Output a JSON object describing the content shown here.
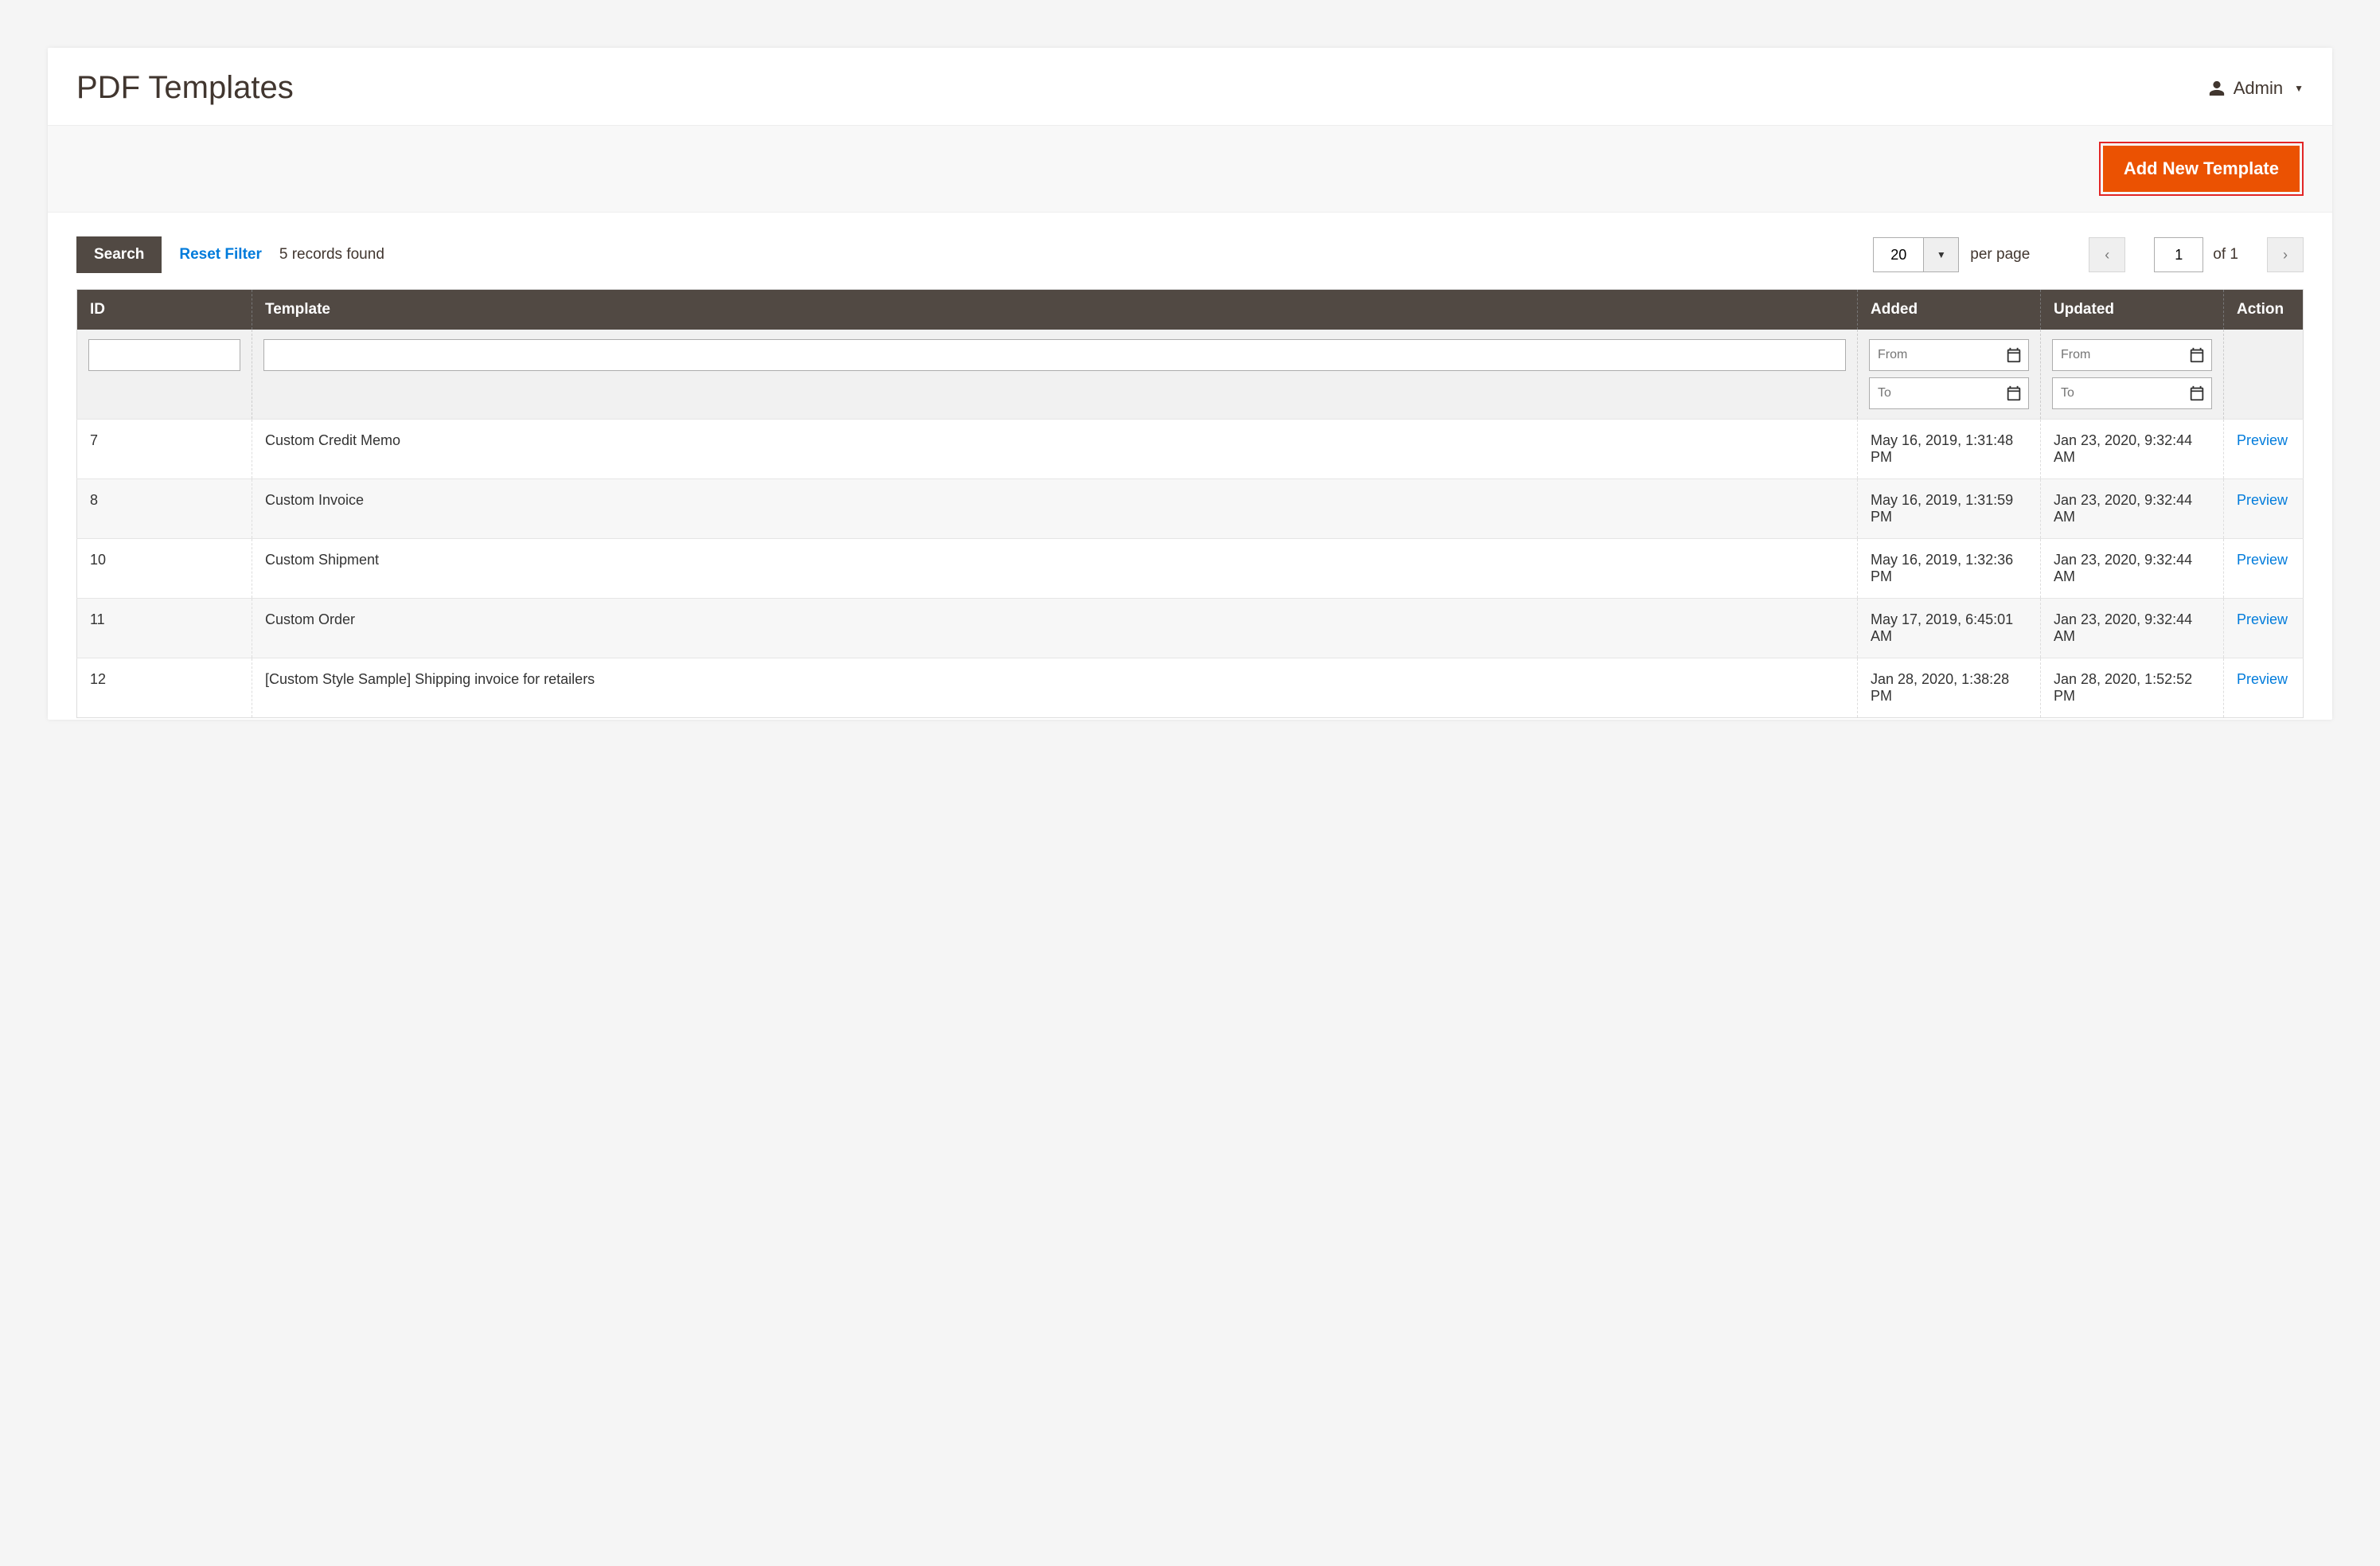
{
  "header": {
    "title": "PDF Templates",
    "user": "Admin"
  },
  "toolbar": {
    "add_label": "Add New Template"
  },
  "controls": {
    "search_label": "Search",
    "reset_label": "Reset Filter",
    "records_found": "5 records found",
    "per_page_value": "20",
    "per_page_label": "per page",
    "page_value": "1",
    "of_label": "of 1"
  },
  "columns": {
    "id": "ID",
    "template": "Template",
    "added": "Added",
    "updated": "Updated",
    "action": "Action"
  },
  "filters": {
    "from_ph": "From",
    "to_ph": "To"
  },
  "action_label": "Preview",
  "rows": [
    {
      "id": "7",
      "template": "Custom Credit Memo",
      "added": "May 16, 2019, 1:31:48 PM",
      "updated": "Jan 23, 2020, 9:32:44 AM"
    },
    {
      "id": "8",
      "template": "Custom Invoice",
      "added": "May 16, 2019, 1:31:59 PM",
      "updated": "Jan 23, 2020, 9:32:44 AM"
    },
    {
      "id": "10",
      "template": "Custom Shipment",
      "added": "May 16, 2019, 1:32:36 PM",
      "updated": "Jan 23, 2020, 9:32:44 AM"
    },
    {
      "id": "11",
      "template": "Custom Order",
      "added": "May 17, 2019, 6:45:01 AM",
      "updated": "Jan 23, 2020, 9:32:44 AM"
    },
    {
      "id": "12",
      "template": "[Custom Style Sample] Shipping invoice for retailers",
      "added": "Jan 28, 2020, 1:38:28 PM",
      "updated": "Jan 28, 2020, 1:52:52 PM"
    }
  ]
}
